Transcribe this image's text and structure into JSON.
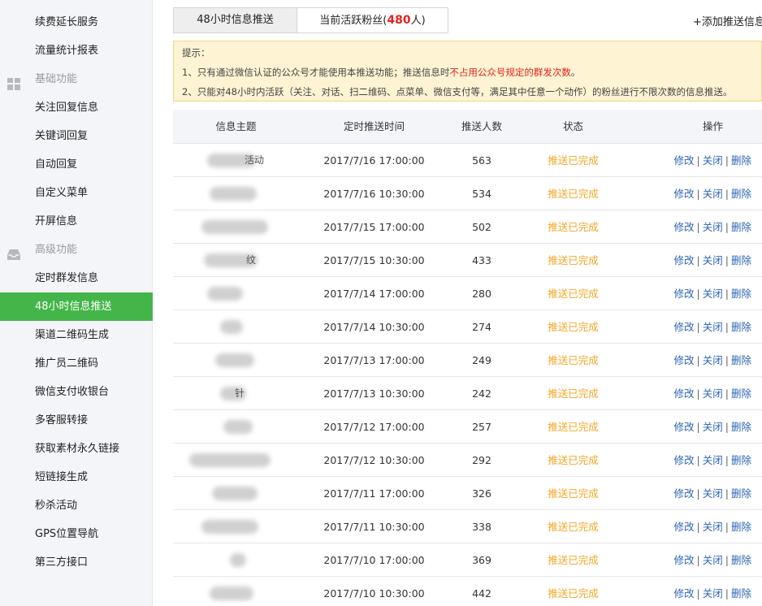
{
  "sidebar": {
    "items": [
      {
        "label": "续费延长服务",
        "type": "item"
      },
      {
        "label": "流量统计报表",
        "type": "item"
      },
      {
        "label": "基础功能",
        "type": "group",
        "icon": "grid-icon"
      },
      {
        "label": "关注回复信息",
        "type": "item"
      },
      {
        "label": "关键词回复",
        "type": "item"
      },
      {
        "label": "自动回复",
        "type": "item"
      },
      {
        "label": "自定义菜单",
        "type": "item"
      },
      {
        "label": "开屏信息",
        "type": "item"
      },
      {
        "label": "高级功能",
        "type": "group",
        "icon": "inbox-icon"
      },
      {
        "label": "定时群发信息",
        "type": "item"
      },
      {
        "label": "48小时信息推送",
        "type": "item",
        "active": true
      },
      {
        "label": "渠道二维码生成",
        "type": "item"
      },
      {
        "label": "推广员二维码",
        "type": "item"
      },
      {
        "label": "微信支付收银台",
        "type": "item"
      },
      {
        "label": "多客服转接",
        "type": "item"
      },
      {
        "label": "获取素材永久链接",
        "type": "item"
      },
      {
        "label": "短链接生成",
        "type": "item"
      },
      {
        "label": "秒杀活动",
        "type": "item"
      },
      {
        "label": "GPS位置导航",
        "type": "item"
      },
      {
        "label": "第三方接口",
        "type": "item"
      }
    ]
  },
  "tabs": {
    "push": "48小时信息推送",
    "fans_prefix": "当前活跃粉丝(",
    "fans_count": "480",
    "fans_suffix": "人)"
  },
  "add_link": "+添加推送信息",
  "notice": {
    "title": "提示：",
    "line1_a": "1、只有通过微信认证的公众号才能使用本推送功能；推送信息时",
    "line1_red": "不占用公众号规定的群发次数",
    "line1_b": "。",
    "line2": "2、只能对48小时内活跃（关注、对话、扫二维码、点菜单、微信支付等，满足其中任意一个动作）的粉丝进行不限次数的信息推送。"
  },
  "table": {
    "headers": [
      "信息主题",
      "定时推送时间",
      "推送人数",
      "状态",
      "操作"
    ],
    "ops": [
      "修改",
      "关闭",
      "删除"
    ],
    "rows": [
      {
        "title_fragment": "活动",
        "time": "2017/7/16 17:00:00",
        "count": "563",
        "status": "推送已完成"
      },
      {
        "title_fragment": "",
        "time": "2017/7/16 10:30:00",
        "count": "534",
        "status": "推送已完成"
      },
      {
        "title_fragment": "",
        "time": "2017/7/15 17:00:00",
        "count": "502",
        "status": "推送已完成"
      },
      {
        "title_fragment": "纹",
        "time": "2017/7/15 10:30:00",
        "count": "433",
        "status": "推送已完成"
      },
      {
        "title_fragment": "",
        "time": "2017/7/14 17:00:00",
        "count": "280",
        "status": "推送已完成"
      },
      {
        "title_fragment": "",
        "time": "2017/7/14 10:30:00",
        "count": "274",
        "status": "推送已完成"
      },
      {
        "title_fragment": "",
        "time": "2017/7/13 17:00:00",
        "count": "249",
        "status": "推送已完成"
      },
      {
        "title_fragment": "针",
        "time": "2017/7/13 10:30:00",
        "count": "242",
        "status": "推送已完成"
      },
      {
        "title_fragment": "",
        "time": "2017/7/12 17:00:00",
        "count": "257",
        "status": "推送已完成"
      },
      {
        "title_fragment": "",
        "time": "2017/7/12 10:30:00",
        "count": "292",
        "status": "推送已完成"
      },
      {
        "title_fragment": "",
        "time": "2017/7/11 17:00:00",
        "count": "326",
        "status": "推送已完成"
      },
      {
        "title_fragment": "",
        "time": "2017/7/11 10:30:00",
        "count": "338",
        "status": "推送已完成"
      },
      {
        "title_fragment": "",
        "time": "2017/7/10 17:00:00",
        "count": "369",
        "status": "推送已完成"
      },
      {
        "title_fragment": "",
        "time": "2017/7/10 10:30:00",
        "count": "442",
        "status": "推送已完成"
      }
    ]
  },
  "colors": {
    "accent_green": "#44b549",
    "status_orange": "#f5a623",
    "link_blue": "#2d64b3",
    "warning_red": "#e5231b",
    "notice_bg": "#fef3d2"
  }
}
